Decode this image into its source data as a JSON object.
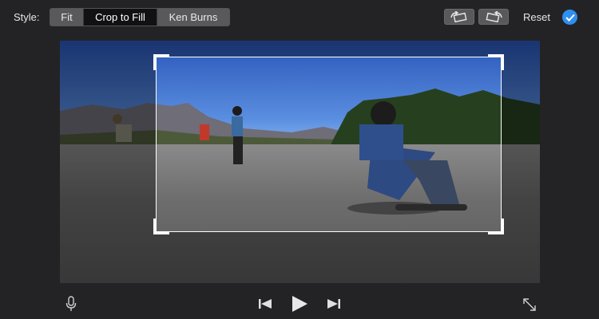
{
  "toolbar": {
    "style_label": "Style:",
    "style_options": [
      {
        "label": "Fit",
        "active": false
      },
      {
        "label": "Crop to Fill",
        "active": true
      },
      {
        "label": "Ken Burns",
        "active": false
      }
    ],
    "rotate_left_icon": "rotate-counterclockwise-icon",
    "rotate_right_icon": "rotate-clockwise-icon",
    "reset_label": "Reset",
    "apply_icon": "checkmark-icon"
  },
  "viewer": {
    "image": "skateboarders-downhill-photo",
    "crop_mode": "Crop to Fill"
  },
  "playback": {
    "mic_icon": "microphone-icon",
    "prev_icon": "skip-back-icon",
    "play_icon": "play-icon",
    "next_icon": "skip-forward-icon",
    "fullscreen_icon": "expand-icon"
  },
  "colors": {
    "background": "#232325",
    "segment_bg": "#59595b",
    "segment_active": "#111113",
    "accent": "#2f8ff0",
    "crop_frame": "#ffffff"
  }
}
